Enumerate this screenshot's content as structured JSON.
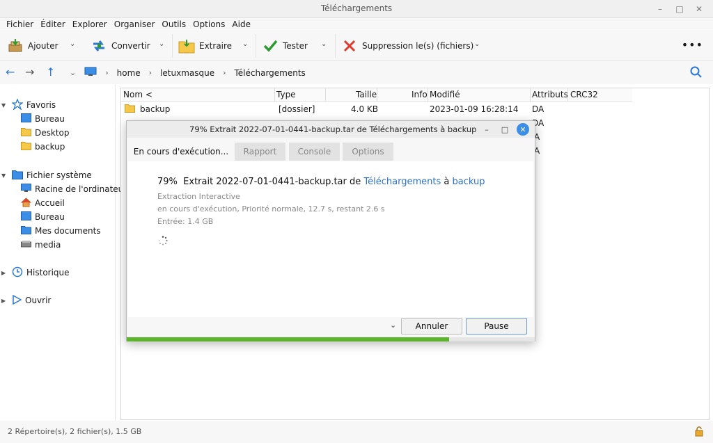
{
  "window": {
    "title": "Téléchargements",
    "controls": [
      "–",
      "□",
      "✕"
    ]
  },
  "menu": [
    "Fichier",
    "Éditer",
    "Explorer",
    "Organiser",
    "Outils",
    "Options",
    "Aide"
  ],
  "toolbar": {
    "add": "Ajouter",
    "convert": "Convertir",
    "extract": "Extraire",
    "test": "Tester",
    "delete": "Suppression le(s) (fichiers)"
  },
  "path": [
    "home",
    "letuxmasque",
    "Téléchargements"
  ],
  "sidebar": {
    "favorites_label": "Favoris",
    "favorites": [
      "Bureau",
      "Desktop",
      "backup"
    ],
    "fs_label": "Fichier système",
    "fs_items": [
      "Racine de l'ordinateur",
      "Accueil",
      "Bureau",
      "Mes documents",
      "media"
    ],
    "history_label": "Historique",
    "open_label": "Ouvrir"
  },
  "columns": [
    "Nom <",
    "Type",
    "Taille",
    "Info",
    "Modifié",
    "Attributs",
    "CRC32"
  ],
  "rows": [
    {
      "name": "backup",
      "type": "[dossier]",
      "size": "4.0 KB",
      "modified": "2023-01-09 16:28:14",
      "attributes": "DA"
    }
  ],
  "partial_attrs": [
    "DA",
    "A",
    "A"
  ],
  "status": "2 Répertoire(s), 2 fichier(s), 1.5 GB",
  "dialog": {
    "title": "79% Extrait 2022-07-01-0441-backup.tar de Téléchargements  à backup",
    "tabs": [
      "En cours d'exécution...",
      "Rapport",
      "Console",
      "Options"
    ],
    "percent_text": "79%",
    "line_mid": "Extrait 2022-07-01-0441-backup.tar de",
    "source": "Téléchargements",
    "to": "à",
    "dest": "backup",
    "mode": "Extraction Interactive",
    "state": "en cours d'exécution, Priorité normale, 12.7 s, restant 2.6 s",
    "input": "Entrée: 1.4 GB",
    "cancel": "Annuler",
    "pause": "Pause",
    "progress": 0.79,
    "progress_color": "#5ab52a"
  }
}
